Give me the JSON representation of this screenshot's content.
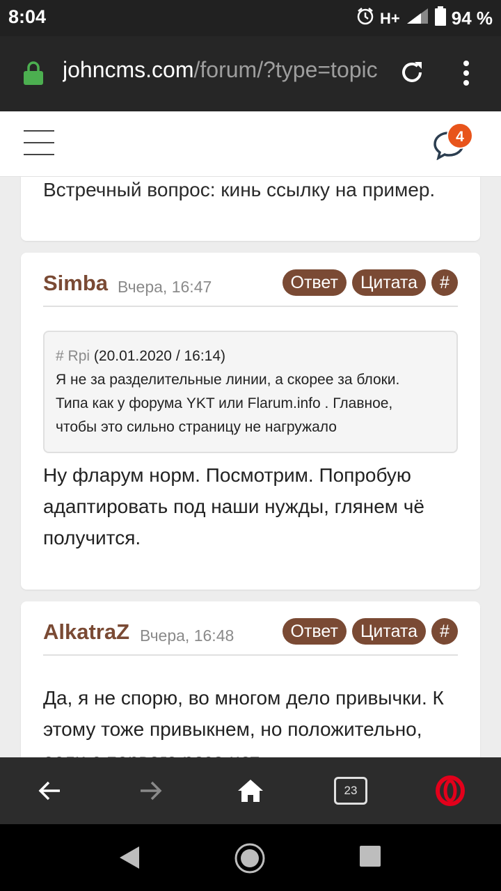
{
  "status": {
    "time": "8:04",
    "network": "H+",
    "battery": "94 %"
  },
  "browser": {
    "url_host": "johncms.com",
    "url_path": "/forum/?type=topic"
  },
  "header": {
    "notifications_count": "4"
  },
  "posts": [
    {
      "text": "Встречный вопрос: кинь ссылку на пример."
    },
    {
      "author": "Simba",
      "date": "Вчера, 16:47",
      "reply_label": "Ответ",
      "quote_label": "Цитата",
      "hash_label": "#",
      "quote": {
        "hash": "#",
        "author": "Rpi",
        "date": "(20.01.2020 / 16:14)",
        "line1": "Я не за разделительные линии, а скорее за блоки.",
        "line2": "Типа как у форума YKT или Flarum.info . Главное,",
        "line3": "чтобы это сильно страницу не нагружало"
      },
      "body": "Ну фларум норм. Посмотрим. Попробую адаптировать под наши нужды, глянем чё получится."
    },
    {
      "author": "AlkatraZ",
      "date": "Вчера, 16:48",
      "reply_label": "Ответ",
      "quote_label": "Цитата",
      "hash_label": "#",
      "body": "Да, я не спорю, во многом дело привычки. К этому тоже привыкнем, но положительно, если с первого раза нет"
    }
  ],
  "bottom_nav": {
    "tab_count": "23"
  }
}
